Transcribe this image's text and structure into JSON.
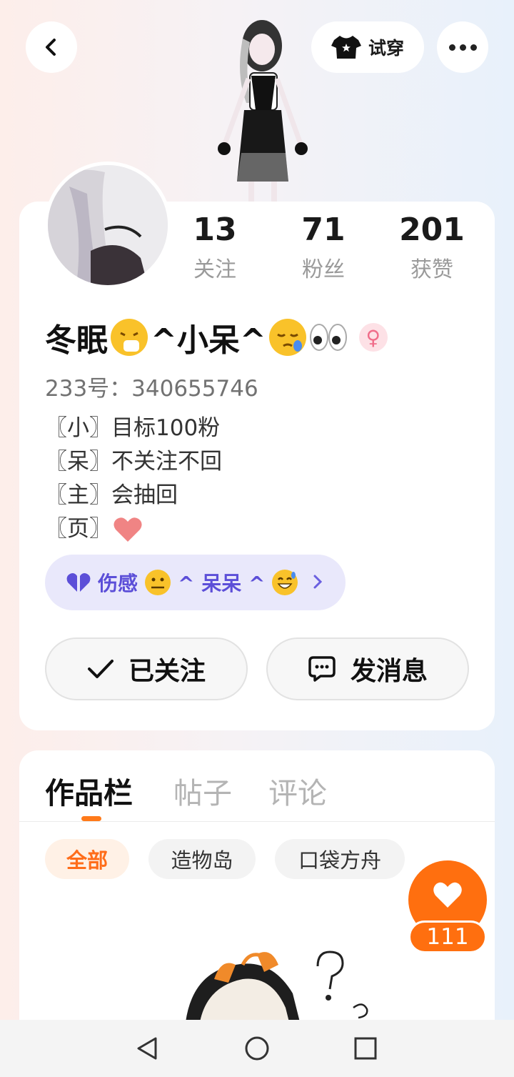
{
  "header": {
    "try_on_label": "试穿",
    "back_icon": "chevron-left-icon",
    "try_on_icon": "tshirt-icon",
    "more_icon": "more-dots-icon"
  },
  "profile": {
    "stats": [
      {
        "value": "13",
        "label": "关注"
      },
      {
        "value": "71",
        "label": "粉丝"
      },
      {
        "value": "201",
        "label": "获赞"
      }
    ],
    "nickname_prefix": "冬眠",
    "nickname_middle": "^小呆^",
    "gender_symbol": "♀",
    "uid": "233号：340655746",
    "bio_lines": [
      "〖小〗目标100粉",
      "〖呆〗不关注不回",
      "〖主〗会抽回",
      "〖页〗"
    ],
    "signature": "伤感",
    "signature_tail": "^ 呆呆 ^",
    "followed_label": "已关注",
    "message_label": "发消息"
  },
  "works": {
    "tabs": [
      "作品栏",
      "帖子",
      "评论"
    ],
    "chips": [
      "全部",
      "造物岛",
      "口袋方舟"
    ],
    "like_count": "111"
  },
  "colors": {
    "accent": "#ff6f0f",
    "signature_bg": "#e9e8fb",
    "signature_text": "#5c4fd8"
  }
}
